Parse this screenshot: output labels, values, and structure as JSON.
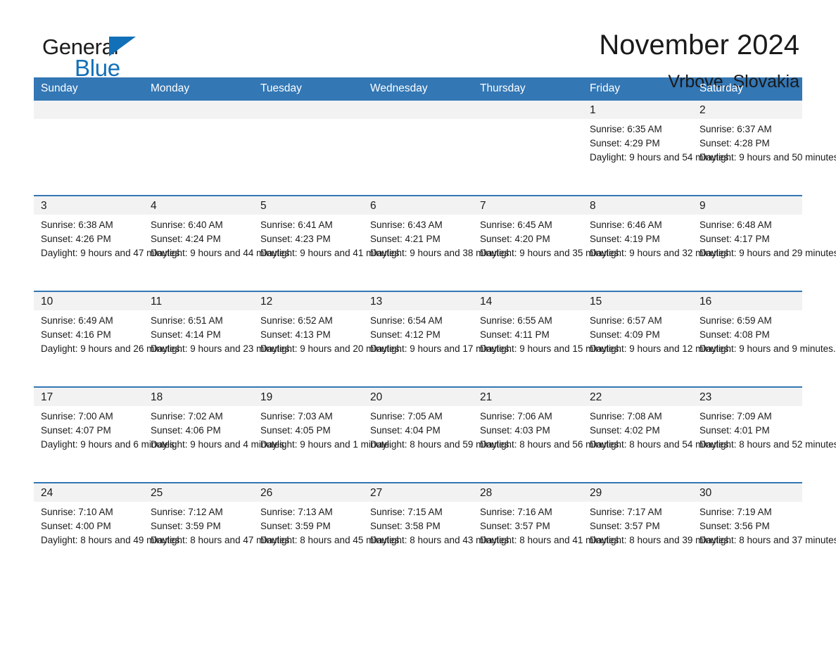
{
  "brand": {
    "name_part1": "General",
    "name_part2": "Blue",
    "logo_triangle": "triangle-icon",
    "accent_color": "#1270b8"
  },
  "header": {
    "month_title": "November 2024",
    "location": "Vrbove, Slovakia"
  },
  "theme": {
    "header_blue": "#3377b5",
    "row_divider_blue": "#3377b5",
    "daynum_band": "#f2f2f2",
    "text": "#1a1a1a"
  },
  "calendar": {
    "weekday_headers": [
      "Sunday",
      "Monday",
      "Tuesday",
      "Wednesday",
      "Thursday",
      "Friday",
      "Saturday"
    ],
    "labels": {
      "sunrise": "Sunrise:",
      "sunset": "Sunset:",
      "daylight": "Daylight:"
    },
    "weeks": [
      [
        {
          "day": "",
          "empty": true
        },
        {
          "day": "",
          "empty": true
        },
        {
          "day": "",
          "empty": true
        },
        {
          "day": "",
          "empty": true
        },
        {
          "day": "",
          "empty": true
        },
        {
          "day": "1",
          "sunrise": "Sunrise: 6:35 AM",
          "sunset": "Sunset: 4:29 PM",
          "daylight": "Daylight: 9 hours and 54 minutes."
        },
        {
          "day": "2",
          "sunrise": "Sunrise: 6:37 AM",
          "sunset": "Sunset: 4:28 PM",
          "daylight": "Daylight: 9 hours and 50 minutes."
        }
      ],
      [
        {
          "day": "3",
          "sunrise": "Sunrise: 6:38 AM",
          "sunset": "Sunset: 4:26 PM",
          "daylight": "Daylight: 9 hours and 47 minutes."
        },
        {
          "day": "4",
          "sunrise": "Sunrise: 6:40 AM",
          "sunset": "Sunset: 4:24 PM",
          "daylight": "Daylight: 9 hours and 44 minutes."
        },
        {
          "day": "5",
          "sunrise": "Sunrise: 6:41 AM",
          "sunset": "Sunset: 4:23 PM",
          "daylight": "Daylight: 9 hours and 41 minutes."
        },
        {
          "day": "6",
          "sunrise": "Sunrise: 6:43 AM",
          "sunset": "Sunset: 4:21 PM",
          "daylight": "Daylight: 9 hours and 38 minutes."
        },
        {
          "day": "7",
          "sunrise": "Sunrise: 6:45 AM",
          "sunset": "Sunset: 4:20 PM",
          "daylight": "Daylight: 9 hours and 35 minutes."
        },
        {
          "day": "8",
          "sunrise": "Sunrise: 6:46 AM",
          "sunset": "Sunset: 4:19 PM",
          "daylight": "Daylight: 9 hours and 32 minutes."
        },
        {
          "day": "9",
          "sunrise": "Sunrise: 6:48 AM",
          "sunset": "Sunset: 4:17 PM",
          "daylight": "Daylight: 9 hours and 29 minutes."
        }
      ],
      [
        {
          "day": "10",
          "sunrise": "Sunrise: 6:49 AM",
          "sunset": "Sunset: 4:16 PM",
          "daylight": "Daylight: 9 hours and 26 minutes."
        },
        {
          "day": "11",
          "sunrise": "Sunrise: 6:51 AM",
          "sunset": "Sunset: 4:14 PM",
          "daylight": "Daylight: 9 hours and 23 minutes."
        },
        {
          "day": "12",
          "sunrise": "Sunrise: 6:52 AM",
          "sunset": "Sunset: 4:13 PM",
          "daylight": "Daylight: 9 hours and 20 minutes."
        },
        {
          "day": "13",
          "sunrise": "Sunrise: 6:54 AM",
          "sunset": "Sunset: 4:12 PM",
          "daylight": "Daylight: 9 hours and 17 minutes."
        },
        {
          "day": "14",
          "sunrise": "Sunrise: 6:55 AM",
          "sunset": "Sunset: 4:11 PM",
          "daylight": "Daylight: 9 hours and 15 minutes."
        },
        {
          "day": "15",
          "sunrise": "Sunrise: 6:57 AM",
          "sunset": "Sunset: 4:09 PM",
          "daylight": "Daylight: 9 hours and 12 minutes."
        },
        {
          "day": "16",
          "sunrise": "Sunrise: 6:59 AM",
          "sunset": "Sunset: 4:08 PM",
          "daylight": "Daylight: 9 hours and 9 minutes."
        }
      ],
      [
        {
          "day": "17",
          "sunrise": "Sunrise: 7:00 AM",
          "sunset": "Sunset: 4:07 PM",
          "daylight": "Daylight: 9 hours and 6 minutes."
        },
        {
          "day": "18",
          "sunrise": "Sunrise: 7:02 AM",
          "sunset": "Sunset: 4:06 PM",
          "daylight": "Daylight: 9 hours and 4 minutes."
        },
        {
          "day": "19",
          "sunrise": "Sunrise: 7:03 AM",
          "sunset": "Sunset: 4:05 PM",
          "daylight": "Daylight: 9 hours and 1 minute."
        },
        {
          "day": "20",
          "sunrise": "Sunrise: 7:05 AM",
          "sunset": "Sunset: 4:04 PM",
          "daylight": "Daylight: 8 hours and 59 minutes."
        },
        {
          "day": "21",
          "sunrise": "Sunrise: 7:06 AM",
          "sunset": "Sunset: 4:03 PM",
          "daylight": "Daylight: 8 hours and 56 minutes."
        },
        {
          "day": "22",
          "sunrise": "Sunrise: 7:08 AM",
          "sunset": "Sunset: 4:02 PM",
          "daylight": "Daylight: 8 hours and 54 minutes."
        },
        {
          "day": "23",
          "sunrise": "Sunrise: 7:09 AM",
          "sunset": "Sunset: 4:01 PM",
          "daylight": "Daylight: 8 hours and 52 minutes."
        }
      ],
      [
        {
          "day": "24",
          "sunrise": "Sunrise: 7:10 AM",
          "sunset": "Sunset: 4:00 PM",
          "daylight": "Daylight: 8 hours and 49 minutes."
        },
        {
          "day": "25",
          "sunrise": "Sunrise: 7:12 AM",
          "sunset": "Sunset: 3:59 PM",
          "daylight": "Daylight: 8 hours and 47 minutes."
        },
        {
          "day": "26",
          "sunrise": "Sunrise: 7:13 AM",
          "sunset": "Sunset: 3:59 PM",
          "daylight": "Daylight: 8 hours and 45 minutes."
        },
        {
          "day": "27",
          "sunrise": "Sunrise: 7:15 AM",
          "sunset": "Sunset: 3:58 PM",
          "daylight": "Daylight: 8 hours and 43 minutes."
        },
        {
          "day": "28",
          "sunrise": "Sunrise: 7:16 AM",
          "sunset": "Sunset: 3:57 PM",
          "daylight": "Daylight: 8 hours and 41 minutes."
        },
        {
          "day": "29",
          "sunrise": "Sunrise: 7:17 AM",
          "sunset": "Sunset: 3:57 PM",
          "daylight": "Daylight: 8 hours and 39 minutes."
        },
        {
          "day": "30",
          "sunrise": "Sunrise: 7:19 AM",
          "sunset": "Sunset: 3:56 PM",
          "daylight": "Daylight: 8 hours and 37 minutes."
        }
      ]
    ]
  }
}
